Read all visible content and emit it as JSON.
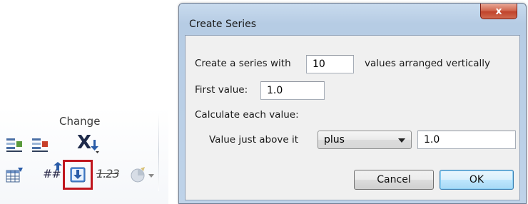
{
  "ribbon": {
    "group_label": "Change",
    "x_label": "X",
    "hash_label": "##",
    "num_label": "1.23"
  },
  "dialog": {
    "title": "Create Series",
    "close_label": "x",
    "series_prefix": "Create a series with",
    "series_count": "10",
    "series_suffix": "values arranged vertically",
    "first_value_label": "First value:",
    "first_value": "1.0",
    "calculate_label": "Calculate each value:",
    "value_above_label": "Value just above it",
    "operator": "plus",
    "operand": "1.0",
    "cancel_label": "Cancel",
    "ok_label": "OK"
  },
  "colors": {
    "highlight": "#c0161e",
    "dialog_frame": "#bfd3e9",
    "close_button": "#c0432b"
  }
}
